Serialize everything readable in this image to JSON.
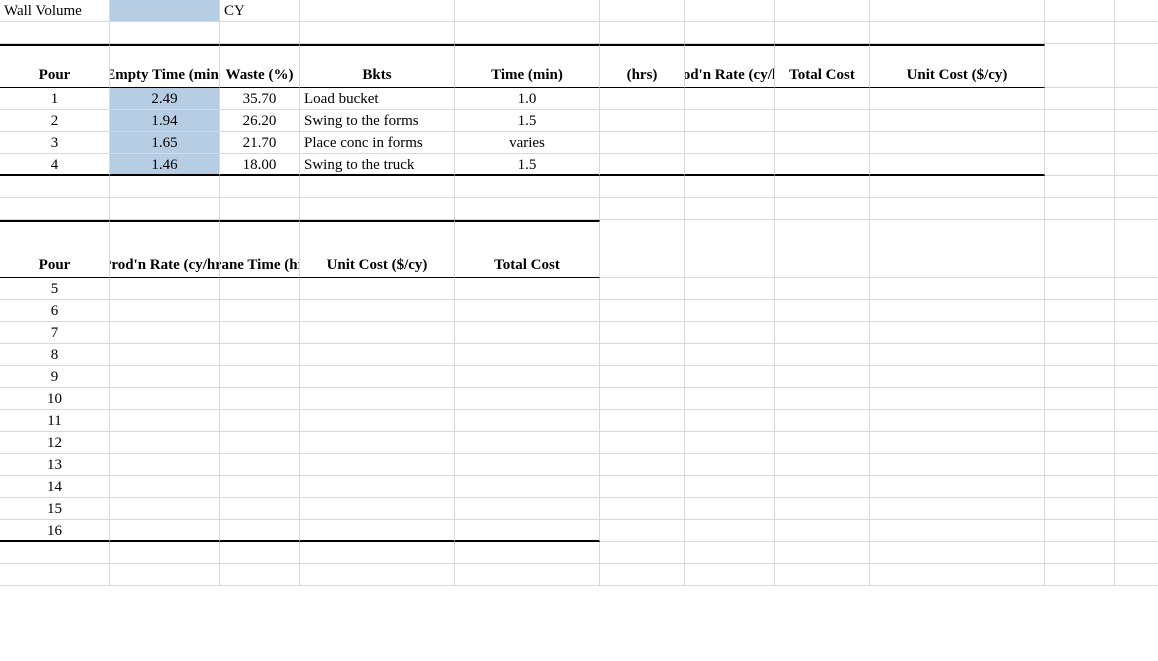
{
  "topRow": {
    "label": "Wall Volume",
    "value": "",
    "unit": "CY"
  },
  "table1": {
    "headers": {
      "pour": "Pour",
      "empty": "Empty Time (min)",
      "waste": "Waste (%)",
      "bkts": "Bkts",
      "time": "Time (min)",
      "hrs": "(hrs)",
      "prodn": "Prod'n Rate (cy/hr)",
      "total": "Total Cost",
      "unit": "Unit Cost ($/cy)"
    },
    "rows": [
      {
        "pour": "1",
        "empty": "2.49",
        "waste": "35.70",
        "bkts": "Load bucket",
        "time": "1.0"
      },
      {
        "pour": "2",
        "empty": "1.94",
        "waste": "26.20",
        "bkts": "Swing to the forms",
        "time": "1.5"
      },
      {
        "pour": "3",
        "empty": "1.65",
        "waste": "21.70",
        "bkts": "Place conc in forms",
        "time": "varies"
      },
      {
        "pour": "4",
        "empty": "1.46",
        "waste": "18.00",
        "bkts": "Swing to the truck",
        "time": "1.5"
      }
    ]
  },
  "table2": {
    "headers": {
      "pour": "Pour",
      "prodn": "Prod'n Rate (cy/hr)",
      "crane": "Crane Time (hrs)",
      "unit": "Unit Cost ($/cy)",
      "total": "Total Cost"
    },
    "rows": [
      {
        "pour": "5"
      },
      {
        "pour": "6"
      },
      {
        "pour": "7"
      },
      {
        "pour": "8"
      },
      {
        "pour": "9"
      },
      {
        "pour": "10"
      },
      {
        "pour": "11"
      },
      {
        "pour": "12"
      },
      {
        "pour": "13"
      },
      {
        "pour": "14"
      },
      {
        "pour": "15"
      },
      {
        "pour": "16"
      }
    ]
  }
}
